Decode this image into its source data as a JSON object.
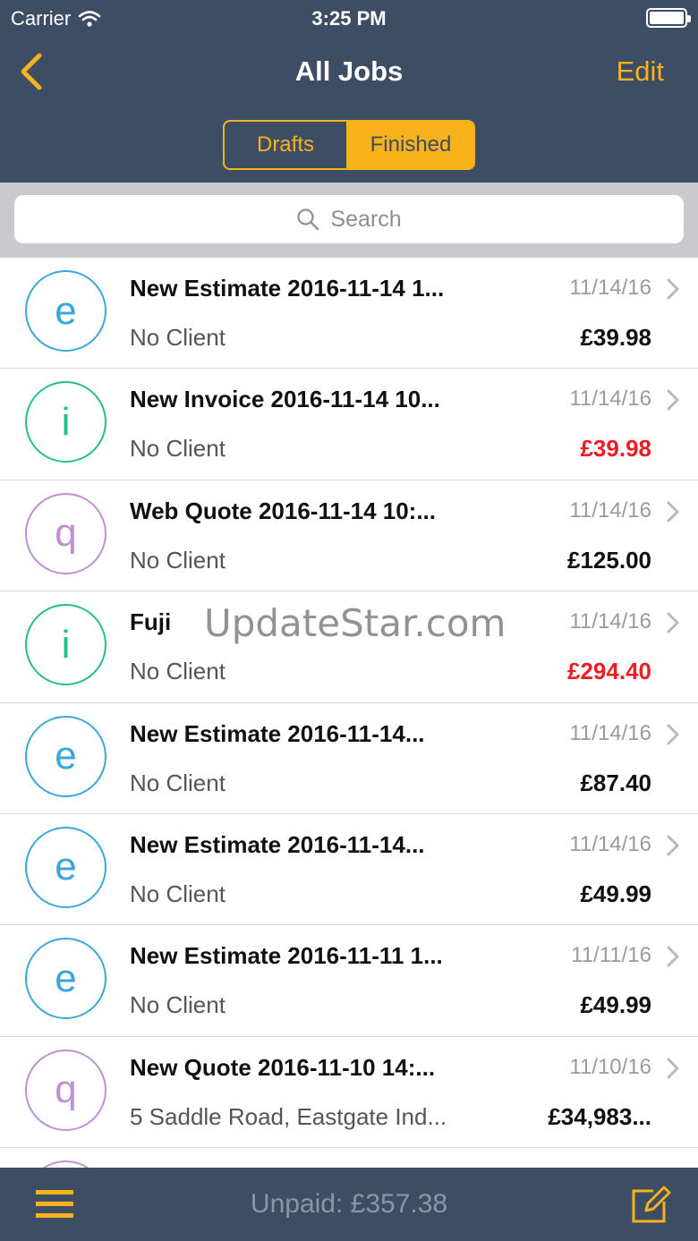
{
  "status": {
    "carrier": "Carrier",
    "time": "3:25 PM"
  },
  "nav": {
    "title": "All Jobs",
    "edit_label": "Edit"
  },
  "tabs": {
    "drafts": "Drafts",
    "finished": "Finished",
    "selected": "Finished"
  },
  "search": {
    "placeholder": "Search"
  },
  "colors": {
    "header": "#3d4d63",
    "accent": "#f8b21c",
    "estimate": "#3aa7dc",
    "invoice": "#22bf86",
    "quote": "#c08fd2",
    "unpaid": "#ee1c24"
  },
  "jobs": [
    {
      "letter": "e",
      "title": "New Estimate 2016-11-14 1...",
      "client": "No Client",
      "date": "11/14/16",
      "amount": "£39.98"
    },
    {
      "letter": "i",
      "title": "New Invoice 2016-11-14 10...",
      "client": "No Client",
      "date": "11/14/16",
      "amount": "£39.98"
    },
    {
      "letter": "q",
      "title": "Web Quote 2016-11-14 10:...",
      "client": "No Client",
      "date": "11/14/16",
      "amount": "£125.00"
    },
    {
      "letter": "i",
      "title": "Fuji",
      "client": "No Client",
      "date": "11/14/16",
      "amount": "£294.40"
    },
    {
      "letter": "e",
      "title": "New Estimate 2016-11-14...",
      "client": "No Client",
      "date": "11/14/16",
      "amount": "£87.40"
    },
    {
      "letter": "e",
      "title": "New Estimate 2016-11-14...",
      "client": "No Client",
      "date": "11/14/16",
      "amount": "£49.99"
    },
    {
      "letter": "e",
      "title": "New Estimate 2016-11-11 1...",
      "client": "No Client",
      "date": "11/11/16",
      "amount": "£49.99"
    },
    {
      "letter": "q",
      "title": "New Quote 2016-11-10 14:...",
      "client": "5 Saddle Road, Eastgate Ind...",
      "date": "11/10/16",
      "amount": "£34,983..."
    }
  ],
  "watermark": "UpdateStar.com",
  "footer": {
    "unpaid_label": "Unpaid: £357.38"
  }
}
